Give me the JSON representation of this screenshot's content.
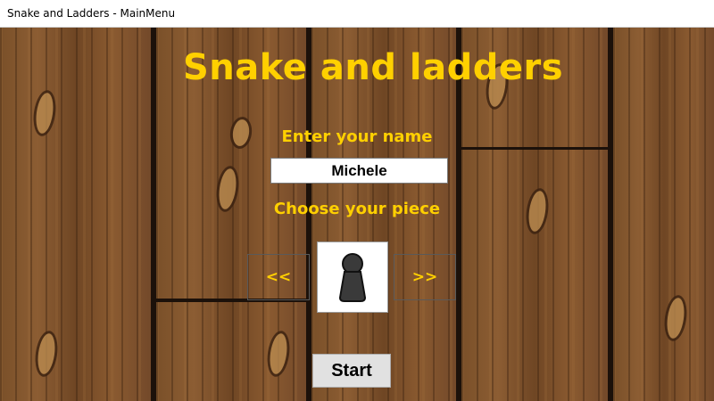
{
  "window": {
    "title": "Snake and Ladders - MainMenu"
  },
  "menu": {
    "title": "Snake and ladders",
    "name_label": "Enter your name",
    "name_value": "Michele",
    "piece_label": "Choose your piece",
    "prev_label": "<<",
    "next_label": ">>",
    "start_label": "Start"
  },
  "colors": {
    "accent": "#ffd000",
    "wood": "#7a5029",
    "piece": "#3a3a3a"
  }
}
